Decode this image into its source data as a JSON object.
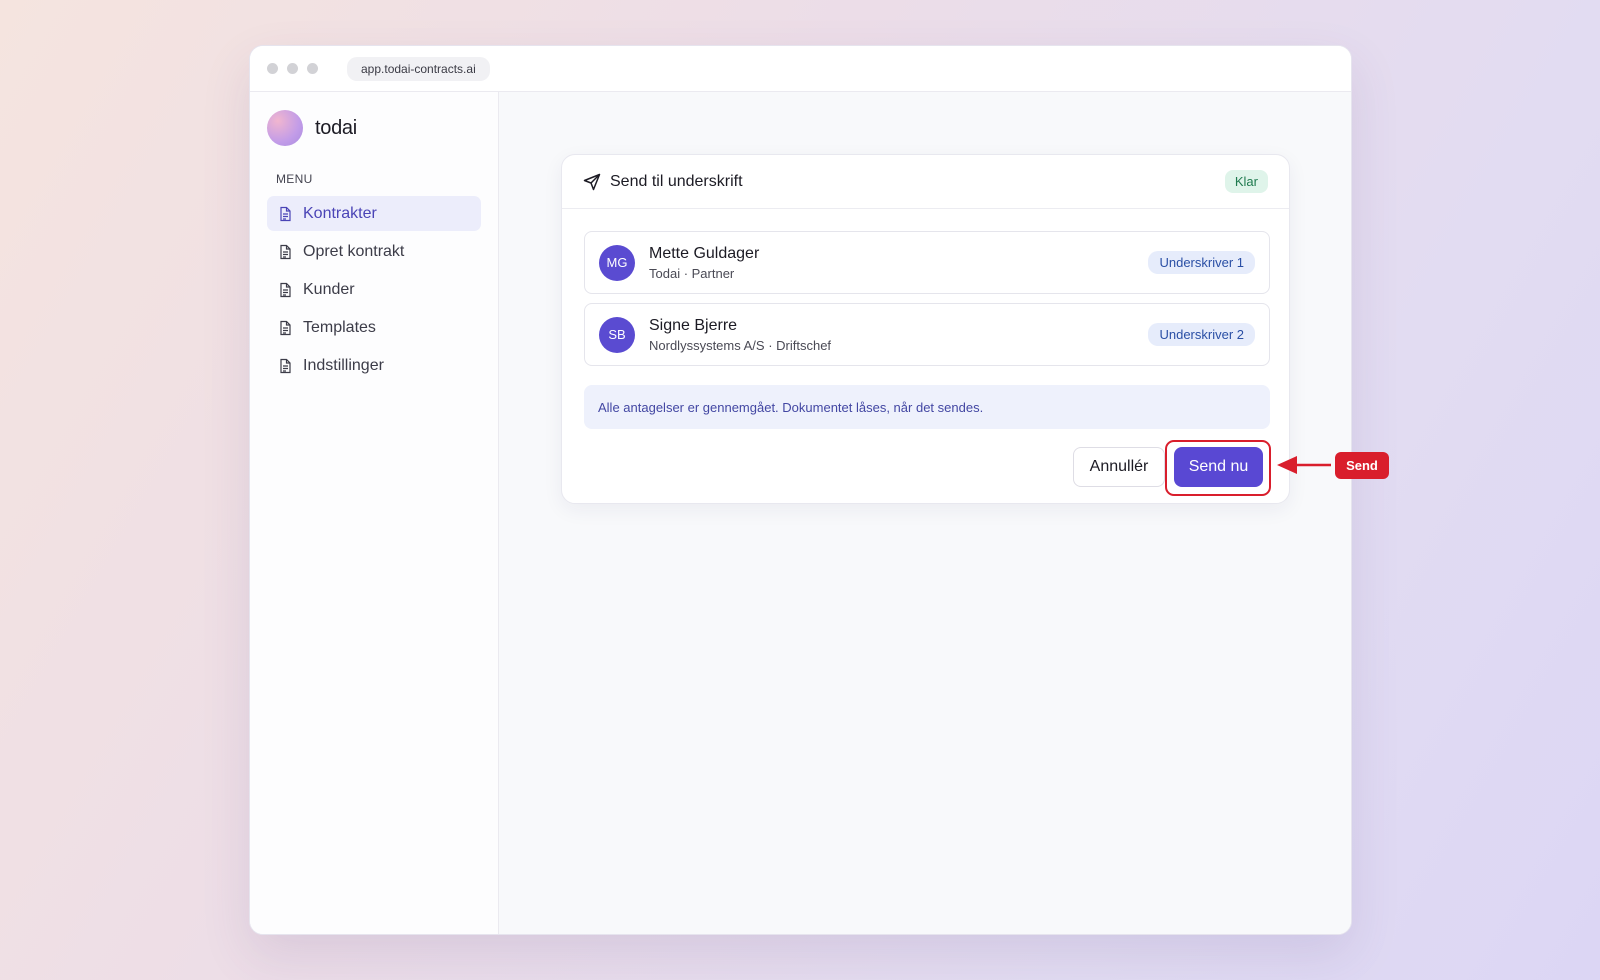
{
  "browser": {
    "url": "app.todai-contracts.ai"
  },
  "brand": {
    "name": "todai"
  },
  "sidebar": {
    "menu_label": "MENU",
    "items": [
      {
        "label": "Kontrakter",
        "active": true
      },
      {
        "label": "Opret kontrakt",
        "active": false
      },
      {
        "label": "Kunder",
        "active": false
      },
      {
        "label": "Templates",
        "active": false
      },
      {
        "label": "Indstillinger",
        "active": false
      }
    ]
  },
  "dialog": {
    "title": "Send til underskrift",
    "status_badge": "Klar",
    "signers": [
      {
        "initials": "MG",
        "name": "Mette Guldager",
        "role": "Todai · Partner",
        "tag": "Underskriver 1"
      },
      {
        "initials": "SB",
        "name": "Signe Bjerre",
        "role": "Nordlyssystems A/S · Driftschef",
        "tag": "Underskriver 2"
      }
    ],
    "notice": "Alle antagelser er gennemgået. Dokumentet låses, når det sendes.",
    "cancel_label": "Annullér",
    "send_label": "Send nu"
  },
  "annotation": {
    "callout_label": "Send",
    "color": "#d91e2c"
  },
  "colors": {
    "accent": "#5948d3",
    "ready": "#1f7a4f"
  }
}
